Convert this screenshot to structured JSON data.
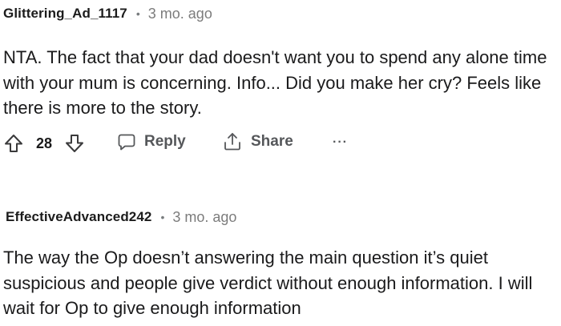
{
  "comments": [
    {
      "author": "Glittering_Ad_1117",
      "separator": "•",
      "time": "3 mo. ago",
      "body": "NTA. The fact that your dad doesn't want you to spend any alone time with your mum is concerning. Info... Did you make her cry? Feels like there is more to the story.",
      "upvotes": "28",
      "actions": {
        "reply": "Reply",
        "share": "Share",
        "more": "···"
      },
      "icons": {
        "upvote": "upvote-arrow-icon",
        "downvote": "downvote-arrow-icon",
        "reply": "speech-bubble-icon",
        "share": "share-upload-icon"
      }
    },
    {
      "author": "EffectiveAdvanced242",
      "separator": "•",
      "time": "3 mo. ago",
      "body": "The way the Op doesn’t answering the main question it’s quiet suspicious and people give verdict without enough information. I will wait for Op to give enough information"
    }
  ],
  "colors": {
    "text": "#1a1a1b",
    "meta": "#7c7c7c",
    "actions": "#55575a"
  }
}
